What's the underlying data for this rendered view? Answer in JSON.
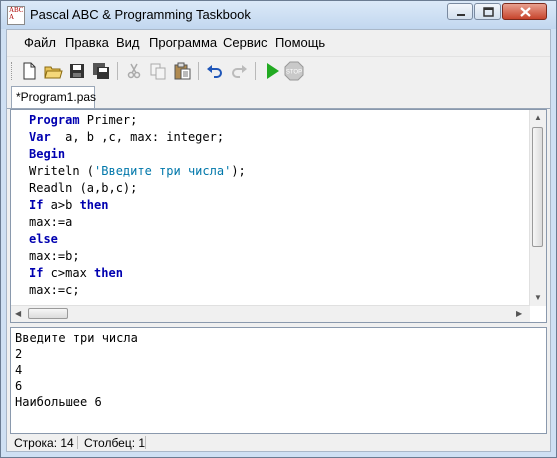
{
  "window": {
    "title": "Pascal ABC & Programming Taskbook",
    "app_icon_text": [
      "ABC",
      "A"
    ]
  },
  "menu": [
    "Файл",
    "Правка",
    "Вид",
    "Программа",
    "Сервис",
    "Помощь"
  ],
  "toolbar": {
    "buttons": [
      "new-file",
      "open-folder",
      "save",
      "save-all",
      "cut",
      "copy",
      "paste",
      "undo",
      "redo",
      "run",
      "stop"
    ],
    "stop_label": "STOP"
  },
  "tab": {
    "label": "Program1.pas",
    "modified_marker": "*"
  },
  "editor": {
    "lines": [
      [
        {
          "k": "kw",
          "t": "Program"
        },
        {
          "k": "n",
          "t": " Primer;"
        }
      ],
      [
        {
          "k": "kw",
          "t": "Var"
        },
        {
          "k": "n",
          "t": "  a, b ,c, max: integer;"
        }
      ],
      [
        {
          "k": "kw",
          "t": "Begin"
        }
      ],
      [
        {
          "k": "n",
          "t": "Writeln ("
        },
        {
          "k": "str",
          "t": "'Введите три числа'"
        },
        {
          "k": "n",
          "t": ");"
        }
      ],
      [
        {
          "k": "n",
          "t": "Readln (a,b,c);"
        }
      ],
      [
        {
          "k": "kw",
          "t": "If"
        },
        {
          "k": "n",
          "t": " a>b "
        },
        {
          "k": "kw",
          "t": "then"
        }
      ],
      [
        {
          "k": "n",
          "t": "max:=a"
        }
      ],
      [
        {
          "k": "kw",
          "t": "else"
        }
      ],
      [
        {
          "k": "n",
          "t": "max:=b;"
        }
      ],
      [
        {
          "k": "kw",
          "t": "If"
        },
        {
          "k": "n",
          "t": " c>max "
        },
        {
          "k": "kw",
          "t": "then"
        }
      ],
      [
        {
          "k": "n",
          "t": "max:=c;"
        }
      ]
    ]
  },
  "output": {
    "lines": [
      "Введите три числа",
      "2",
      "4",
      "6",
      "Наибольшее 6"
    ]
  },
  "status": {
    "row_label": "Строка: 14",
    "col_label": "Столбец: 1"
  },
  "colors": {
    "keyword": "#0000b0",
    "string": "#0077aa",
    "title_bar": "#c2d7ef"
  }
}
